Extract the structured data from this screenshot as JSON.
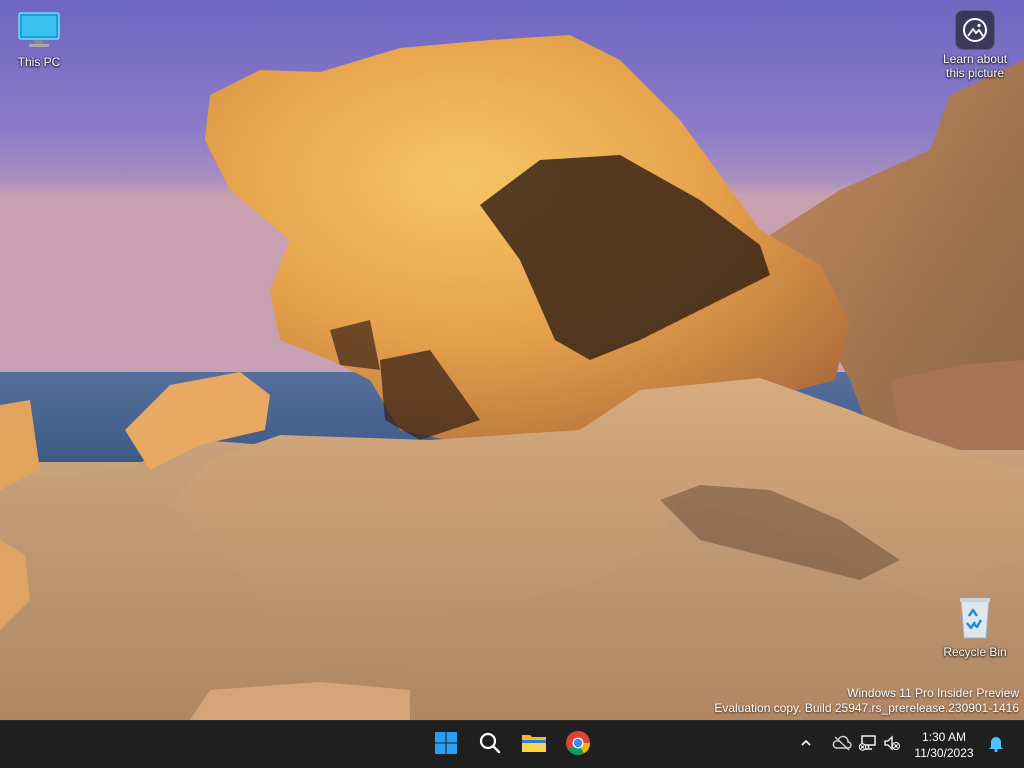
{
  "desktop": {
    "icons": {
      "this_pc": {
        "label": "This PC",
        "icon": "monitor-icon"
      },
      "learn": {
        "label": "Learn about this picture",
        "icon": "camera-info-icon"
      },
      "recycle_bin": {
        "label": "Recycle Bin",
        "icon": "recycle-bin-icon"
      }
    },
    "watermark": {
      "line1": "Windows 11 Pro Insider Preview",
      "line2": "Evaluation copy. Build 25947.rs_prerelease.230901-1416"
    }
  },
  "taskbar": {
    "pinned": [
      {
        "name": "start",
        "icon": "windows-logo-icon"
      },
      {
        "name": "search",
        "icon": "search-icon"
      },
      {
        "name": "file-explorer",
        "icon": "folder-icon"
      },
      {
        "name": "chrome",
        "icon": "chrome-icon"
      }
    ],
    "tray": {
      "icons": [
        "chevron-up-icon",
        "onedrive-offline-icon",
        "network-disconnected-icon",
        "volume-muted-icon",
        "notification-bell-icon"
      ]
    },
    "clock": {
      "time": "1:30 AM",
      "date": "11/30/2023"
    }
  },
  "colors": {
    "taskbar_bg": "#1f1f1f",
    "accent_blue": "#0078d4",
    "text": "#ffffff"
  }
}
